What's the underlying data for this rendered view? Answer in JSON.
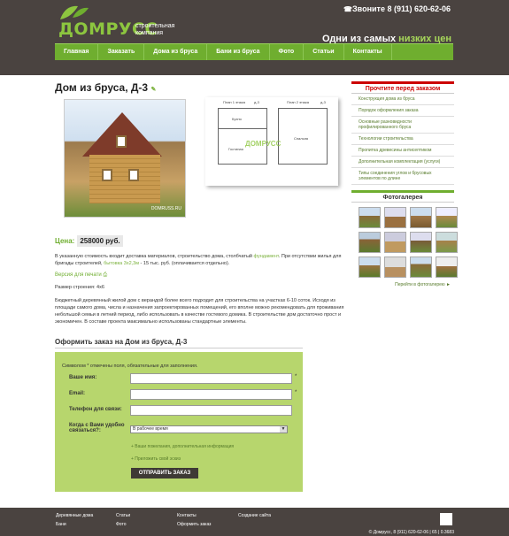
{
  "header": {
    "logo": "ДОМРУСС",
    "logo_sub_1": "строительная",
    "logo_sub_2": "компания",
    "phone": "Звоните 8 (911) 620-62-06",
    "slogan_a": "Одни из самых",
    "slogan_b": "низких цен"
  },
  "nav": [
    "Главная",
    "Заказать",
    "Дома из бруса",
    "Бани из бруса",
    "Фото",
    "Статьи",
    "Контакты"
  ],
  "page": {
    "title": "Дом из бруса, Д-3",
    "price_label": "Цена:",
    "price": "258000 руб.",
    "desc_1": "В указанную стоимость входит доставка материалов, строительство дома, столбчатый",
    "desc_link": "фундамент",
    "desc_2": ". При отсутствии жилья для бригады строителей,",
    "desc_link2": "бытовка 3х2,3м",
    "desc_3": " - 15 тыс. руб. (оплачивается отдельно).",
    "print": "Версия для печати",
    "size": "Размер строения: 4х6",
    "long": "Бюджетный деревянный жилой дом с верандой более всего подходит для строительства на участках 6-10 соток. Исходя из площади самого дома, числа и назначения запроектированных помещений, его вполне можно рекомендовать для проживания небольшой семьи в летний период, либо использовать в качестве гостевого домика. В строительстве дом достаточно прост и экономичен. В составе проекта максимально использованы стандартные элементы.",
    "photo_watermark": "DOMRUSS.RU"
  },
  "plan": {
    "title1": "План 1 этажа",
    "title2": "План 2 этажа",
    "code": "д-3",
    "room1": "Кухня",
    "room2": "Гостиная",
    "room3": "Спальня",
    "wm": "ДОМРУСС"
  },
  "form": {
    "title": "Оформить заказ на Дом из бруса, Д-3",
    "note": "Символом * отмечены поля, обязательные для заполнения.",
    "name_label": "Ваше имя:",
    "email_label": "Email:",
    "phone_label": "Телефон для связи:",
    "time_label": "Когда с Вами удобно связаться?:",
    "time_value": "В рабочее время",
    "wishes_link": "+ Ваши пожелания, дополнительная информация",
    "sketch_link": "+ Приложить свой эскиз",
    "submit": "ОТПРАВИТЬ ЗАКАЗ"
  },
  "sidebar": {
    "title": "Прочтите перед заказом",
    "items": [
      "Конструкция дома из бруса",
      "Порядок оформления заказа",
      "Основные разновидности профилированного бруса",
      "Технологии строительства",
      "Пропитка древесины антисептиком",
      "Дополнительная комплектация (услуги)",
      "Типы соединения углов и брусовых элементов по длине"
    ],
    "gallery_title": "Фотогалерея",
    "gallery_link": "Перейти в фотогалерею ►"
  },
  "footer": {
    "links": [
      "Деревянные дома",
      "Статьи",
      "Контакты",
      "Создание сайта",
      "Бани",
      "Фото",
      "Оформить заказ"
    ],
    "copy": "© Домрусс, 8 (911) 620-62-06 | 65 | 0.3683"
  },
  "colors": {
    "accent": "#6fae2f",
    "dark": "#4a4340",
    "form_bg": "#b7d66d",
    "sidebar_title": "#cc0000"
  }
}
